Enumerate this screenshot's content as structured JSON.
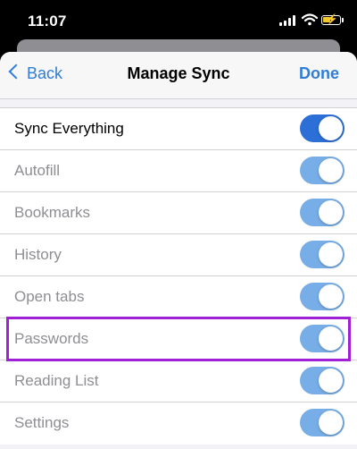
{
  "status_bar": {
    "time": "11:07"
  },
  "nav": {
    "back_label": "Back",
    "title": "Manage Sync",
    "done_label": "Done"
  },
  "sync_items": [
    {
      "label": "Sync Everything",
      "on": true,
      "primary": true
    },
    {
      "label": "Autofill",
      "on": true,
      "primary": false
    },
    {
      "label": "Bookmarks",
      "on": true,
      "primary": false
    },
    {
      "label": "History",
      "on": true,
      "primary": false
    },
    {
      "label": "Open tabs",
      "on": true,
      "primary": false
    },
    {
      "label": "Passwords",
      "on": true,
      "primary": false,
      "highlighted": true
    },
    {
      "label": "Reading List",
      "on": true,
      "primary": false
    },
    {
      "label": "Settings",
      "on": true,
      "primary": false
    }
  ],
  "colors": {
    "accent": "#2f7dd6",
    "highlight": "#a020d6",
    "toggle_on": "#2c6fd6",
    "toggle_on_disabled": "#78aee8"
  }
}
